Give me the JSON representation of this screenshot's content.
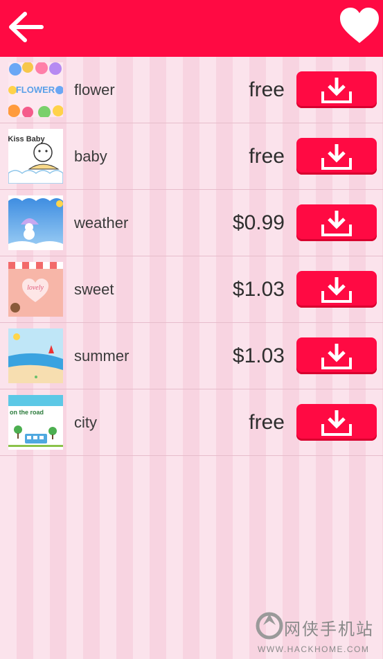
{
  "header": {
    "back_icon": "arrow-left-icon",
    "favorite_icon": "heart-icon",
    "background_color": "#ff0a43"
  },
  "themes": [
    {
      "name": "flower",
      "price": "free",
      "thumb_text": "FLOWER"
    },
    {
      "name": "baby",
      "price": "free",
      "thumb_text": "Kiss Baby"
    },
    {
      "name": "weather",
      "price": "$0.99"
    },
    {
      "name": "sweet",
      "price": "$1.03",
      "thumb_text": "lovely"
    },
    {
      "name": "summer",
      "price": "$1.03"
    },
    {
      "name": "city",
      "price": "free",
      "thumb_text": "on the road"
    }
  ],
  "download_icon": "download-icon",
  "watermark": {
    "chinese": "网侠手机站",
    "english": "WWW.HACKHOME.COM"
  }
}
